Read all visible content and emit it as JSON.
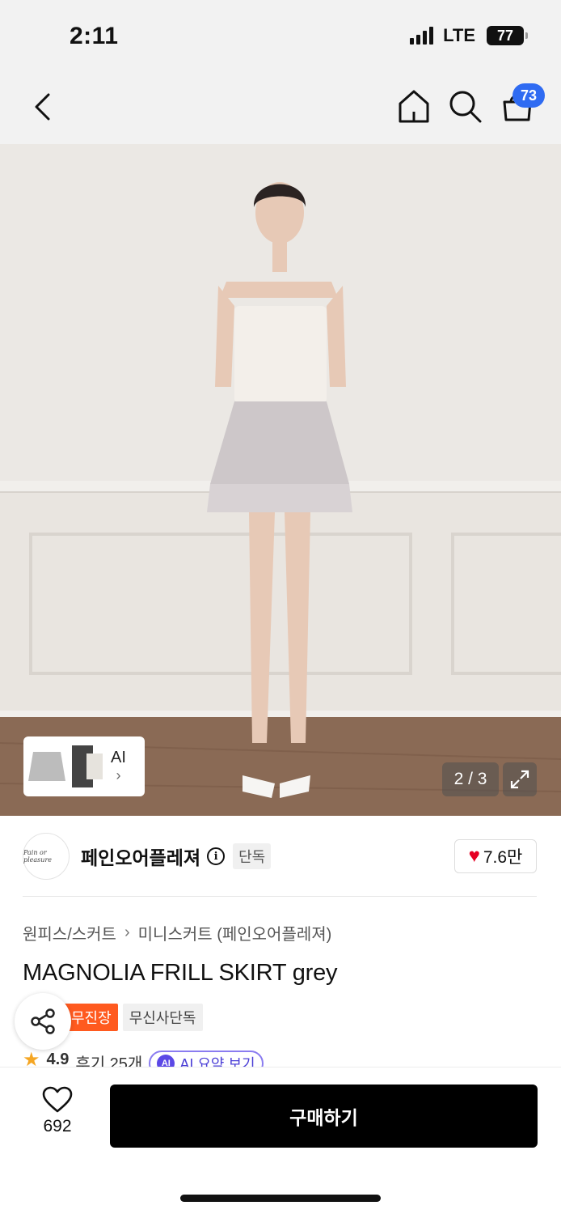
{
  "status_bar": {
    "time": "2:11",
    "network": "LTE",
    "battery": "77"
  },
  "nav": {
    "cart_count": "73",
    "icons": [
      "back-icon",
      "home-icon",
      "search-icon",
      "cart-icon"
    ]
  },
  "gallery": {
    "counter": "2 / 3",
    "thumb_ai_label": "AI",
    "thumb_chevron": "›"
  },
  "brand": {
    "name": "페인오어플레져",
    "info_icon": "i",
    "tag": "단독",
    "logo_text": "Pain or pleasure",
    "likes": "7.6만"
  },
  "product": {
    "breadcrumb": [
      "원피스/스커트",
      "미니스커트 (페인오어플레져)"
    ],
    "title": "MAGNOLIA FRILL SKIRT grey",
    "badges": [
      "무진장",
      "무신사단독"
    ],
    "rating": "4.9",
    "review_count": "후기 25개",
    "ai_summary": "AI 요약 보기",
    "ai_dot": "AI"
  },
  "bottom": {
    "wishlist_count": "692",
    "buy_label": "구매하기"
  },
  "colors": {
    "accent_blue": "#2f6bf2",
    "badge_orange": "#ff5a1f",
    "heart_red": "#e60023",
    "buy_bg": "#000000"
  }
}
